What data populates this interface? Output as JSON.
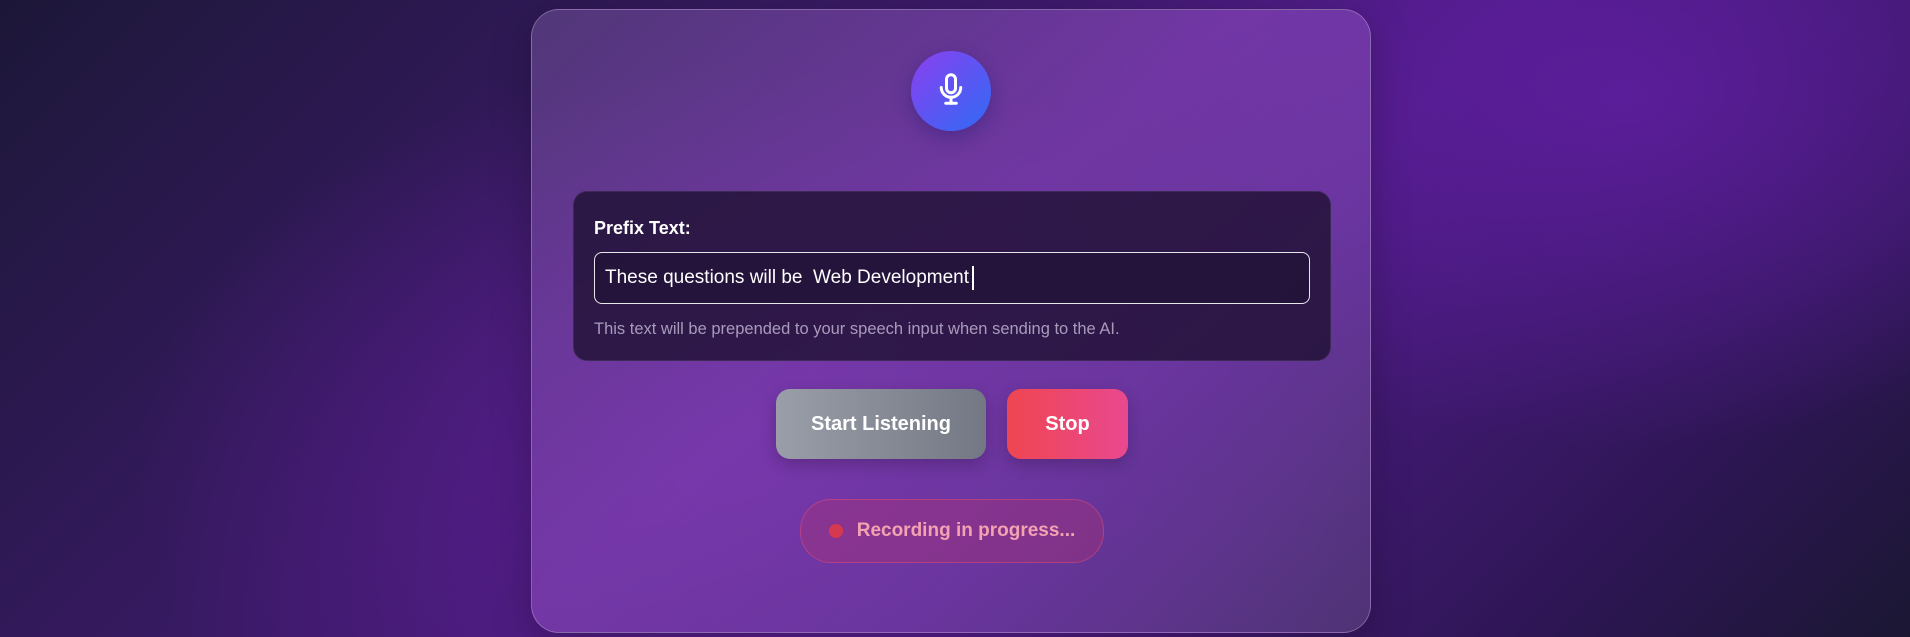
{
  "header": {
    "icon": "microphone-icon"
  },
  "prefix": {
    "label": "Prefix Text:",
    "value": "These questions will be  Web Development",
    "hint": "This text will be prepended to your speech input when sending to the AI."
  },
  "controls": {
    "start_label": "Start Listening",
    "stop_label": "Stop"
  },
  "status": {
    "text": "Recording in progress..."
  },
  "colors": {
    "accent_start": "#8b3ff0",
    "accent_end": "#2f6bf5",
    "stop": "#ef4651",
    "recording_text": "#f3a2b2"
  }
}
